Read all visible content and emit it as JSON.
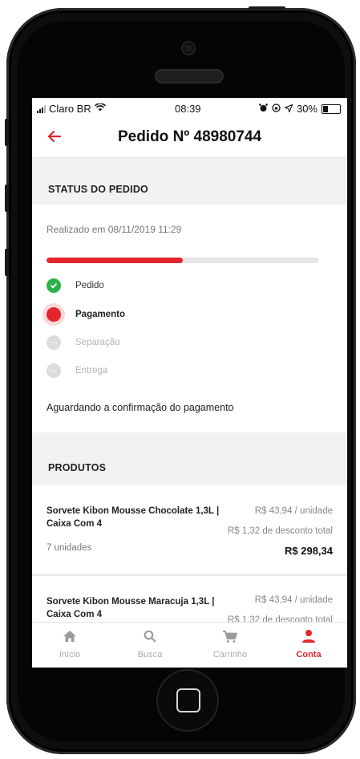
{
  "status_bar": {
    "carrier": "Claro BR",
    "time": "08:39",
    "battery": "30%"
  },
  "header": {
    "title": "Pedido Nº 48980744"
  },
  "status_section": {
    "heading": "STATUS DO PEDIDO",
    "realized": "Realizado em 08/11/2019 11:29",
    "progress_fraction": 0.5,
    "steps": [
      {
        "label": "Pedido",
        "state": "done"
      },
      {
        "label": "Pagamento",
        "state": "current"
      },
      {
        "label": "Separação",
        "state": "pending"
      },
      {
        "label": "Entrega",
        "state": "pending"
      }
    ],
    "message": "Aguardando a confirmação do pagamento"
  },
  "products_section": {
    "heading": "PRODUTOS",
    "items": [
      {
        "name": "Sorvete Kibon Mousse Chocolate 1,3L | Caixa Com 4",
        "unit_price": "R$ 43,94 / unidade",
        "discount": "R$ 1,32 de desconto total",
        "quantity": "7 unidades",
        "total": "R$ 298,34"
      },
      {
        "name": "Sorvete Kibon Mousse Maracuja 1,3L | Caixa Com 4",
        "unit_price": "R$ 43,94 / unidade",
        "discount": "R$ 1,32 de desconto total"
      }
    ]
  },
  "tabbar": {
    "items": [
      {
        "label": "Início",
        "icon": "home-icon"
      },
      {
        "label": "Busca",
        "icon": "search-icon"
      },
      {
        "label": "Carrinho",
        "icon": "cart-icon"
      },
      {
        "label": "Conta",
        "icon": "user-icon"
      }
    ],
    "active": "Conta"
  },
  "colors": {
    "accent": "#e2262b",
    "success": "#2bb04a"
  }
}
